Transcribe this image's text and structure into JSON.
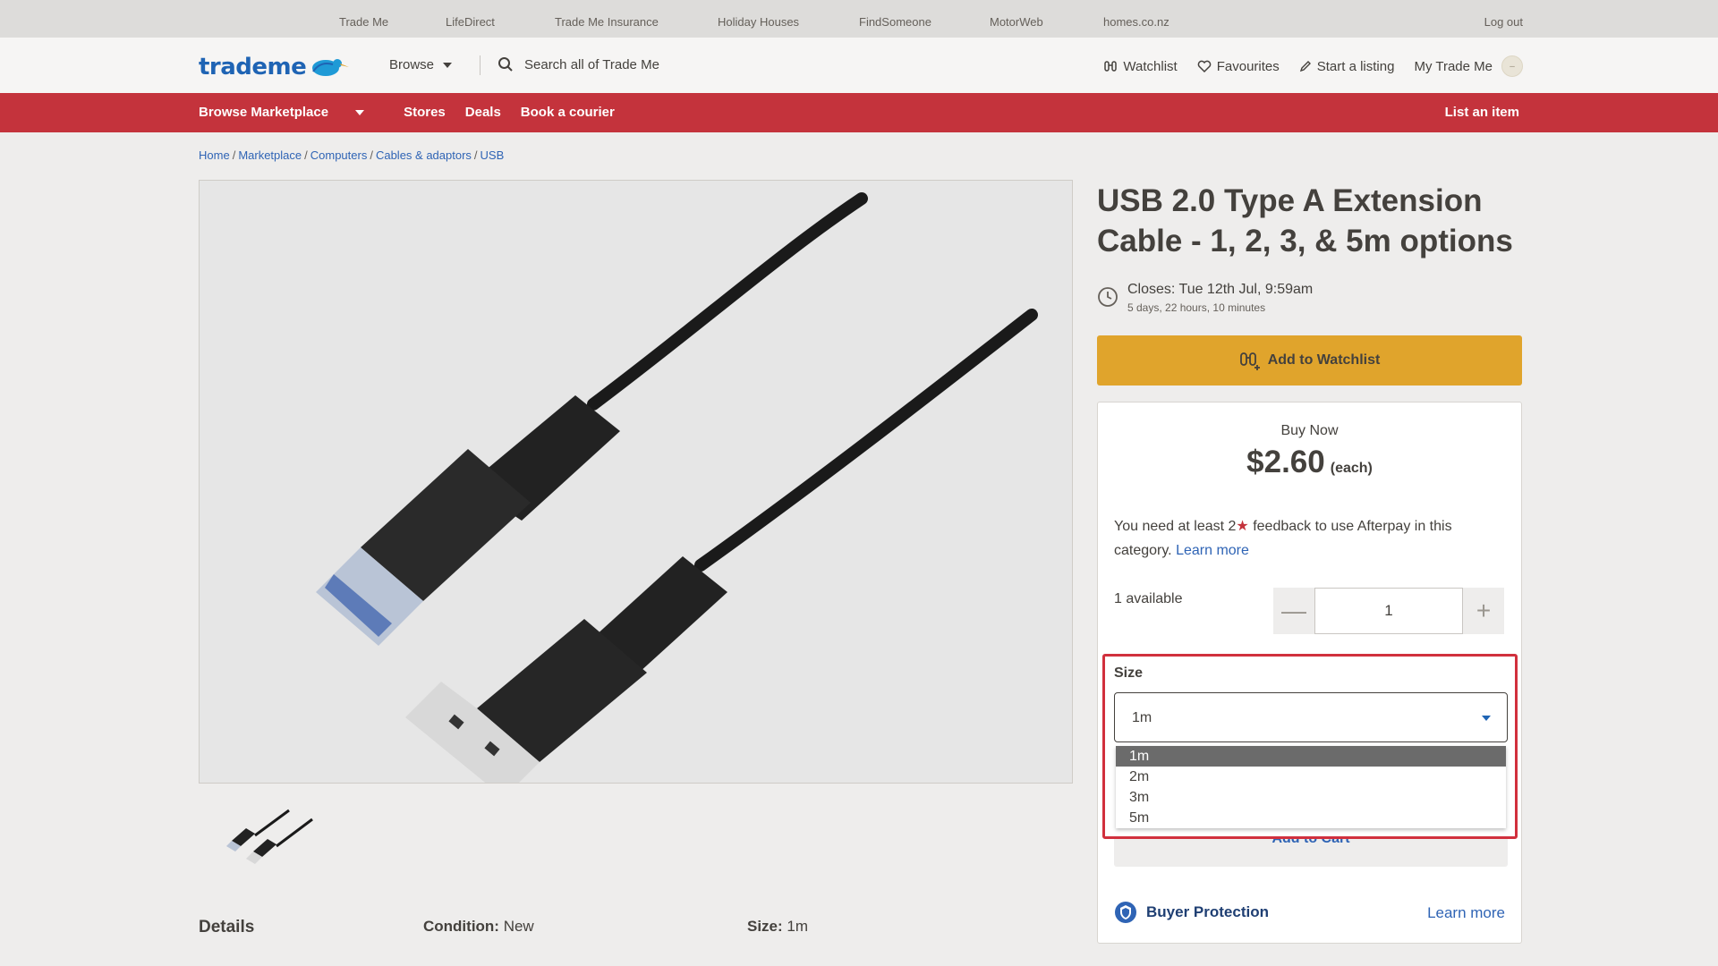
{
  "utility_links": [
    "Trade Me",
    "LifeDirect",
    "Trade Me Insurance",
    "Holiday Houses",
    "FindSomeone",
    "MotorWeb",
    "homes.co.nz"
  ],
  "logout": "Log out",
  "logo_text": "trademe",
  "header": {
    "browse": "Browse",
    "search_placeholder": "Search all of Trade Me",
    "watchlist": "Watchlist",
    "favourites": "Favourites",
    "start_listing": "Start a listing",
    "my_trademe": "My Trade Me"
  },
  "rednav": {
    "browse_marketplace": "Browse Marketplace",
    "stores": "Stores",
    "deals": "Deals",
    "book_courier": "Book a courier",
    "list_item": "List an item"
  },
  "breadcrumb": [
    "Home",
    "Marketplace",
    "Computers",
    "Cables & adaptors",
    "USB"
  ],
  "listing": {
    "title": "USB 2.0 Type A Extension Cable - 1, 2, 3, & 5m options",
    "closes": "Closes: Tue 12th Jul, 9:59am",
    "time_left": "5 days, 22 hours, 10 minutes",
    "watchlist_button": "Add to Watchlist"
  },
  "buy": {
    "label": "Buy Now",
    "price": "$2.60",
    "unit": "(each)",
    "afterpay_pre": "You need at least 2",
    "afterpay_star": "★",
    "afterpay_post": " feedback to use Afterpay in this category. ",
    "afterpay_link": "Learn more",
    "available": "1 available",
    "quantity": "1",
    "minus": "—",
    "plus": "+",
    "size_label": "Size",
    "size_selected": "1m",
    "size_options": [
      "1m",
      "2m",
      "3m",
      "5m"
    ],
    "add_to_cart": "Add to Cart",
    "buyer_protection": "Buyer Protection",
    "protection_link": "Learn more"
  },
  "details": {
    "title": "Details",
    "condition_label": "Condition:",
    "condition_value": "New",
    "size_label": "Size:",
    "size_value": "1m"
  },
  "colors": {
    "brand_red": "#c4333c",
    "watch_gold": "#e0a42c",
    "link_blue": "#2f64b5",
    "highlight_red": "#d1303d"
  }
}
